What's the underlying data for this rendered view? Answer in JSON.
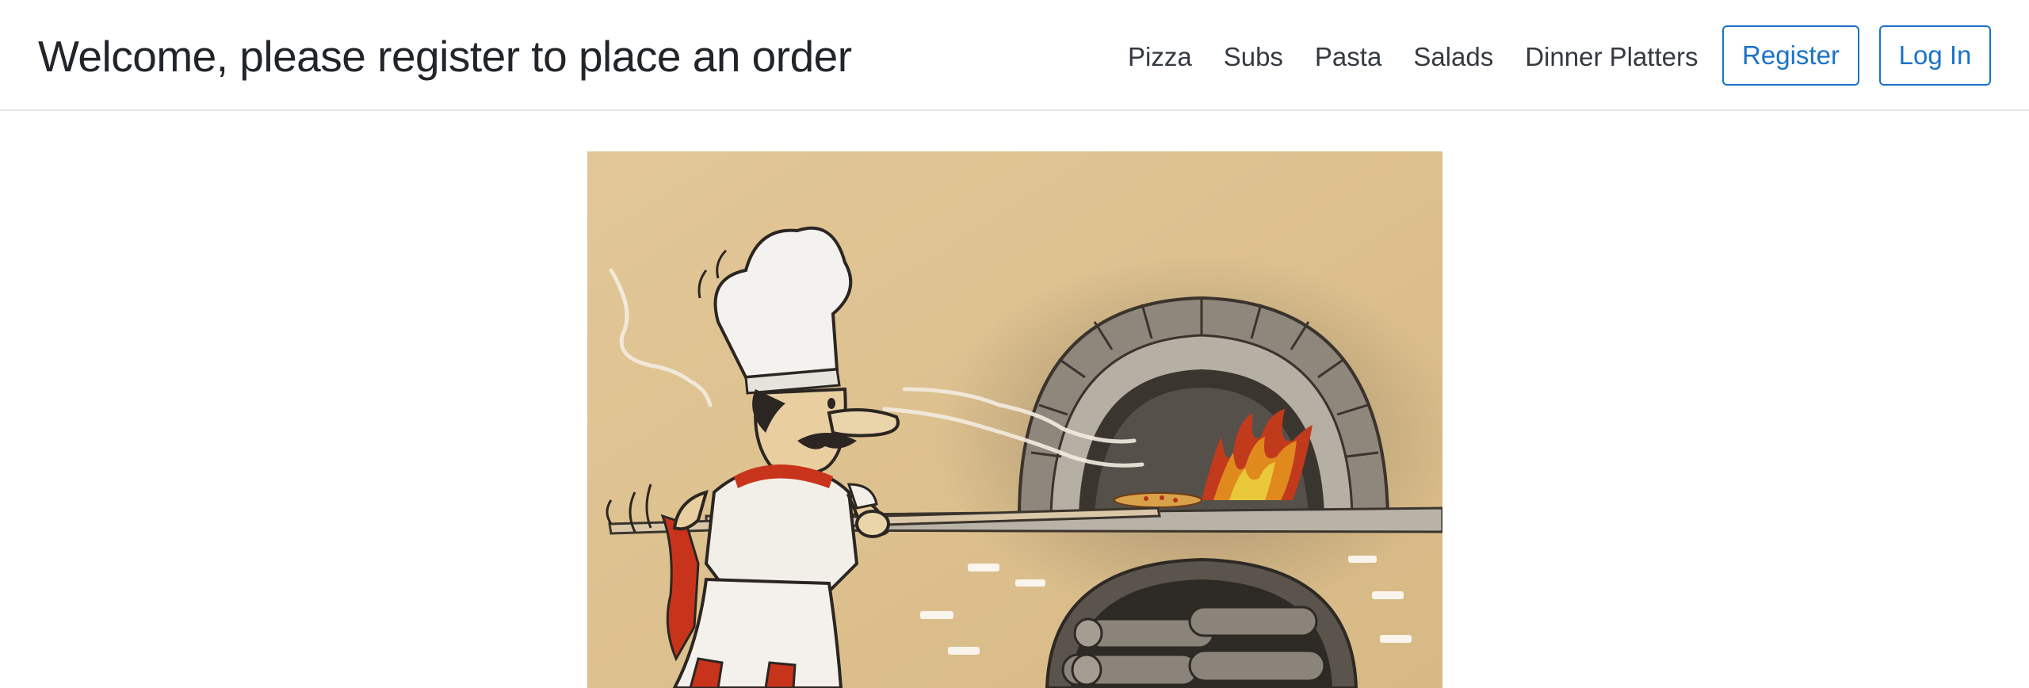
{
  "header": {
    "title": "Welcome, please register to place an order"
  },
  "nav": {
    "items": [
      {
        "label": "Pizza"
      },
      {
        "label": "Subs"
      },
      {
        "label": "Pasta"
      },
      {
        "label": "Salads"
      },
      {
        "label": "Dinner Platters"
      }
    ]
  },
  "auth": {
    "register_label": "Register",
    "login_label": "Log In"
  },
  "colors": {
    "accent": "#1a73c9",
    "hero_background": "#ddc08e"
  }
}
